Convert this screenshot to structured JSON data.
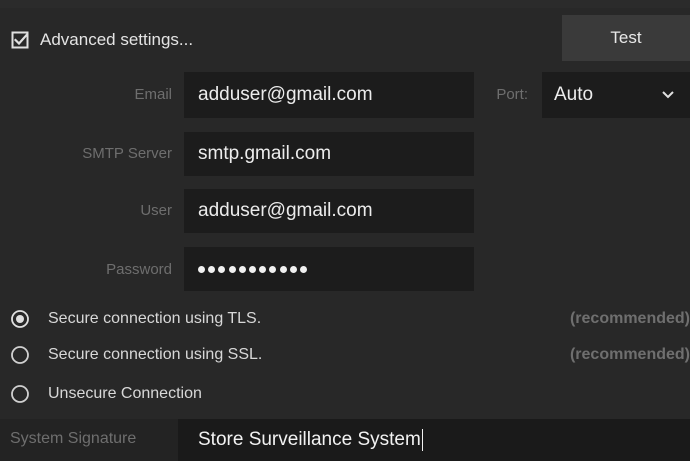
{
  "advanced": {
    "label": "Advanced settings...",
    "checked": true,
    "icon": "checkbox-checked-icon"
  },
  "test_button": {
    "label": "Test"
  },
  "fields": {
    "email": {
      "label": "Email",
      "value": "adduser@gmail.com"
    },
    "smtp_server": {
      "label": "SMTP Server",
      "value": "smtp.gmail.com"
    },
    "user": {
      "label": "User",
      "value": "adduser@gmail.com"
    },
    "password": {
      "label": "Password",
      "masked_length": 11
    }
  },
  "port": {
    "label": "Port:",
    "selected": "Auto",
    "icon": "chevron-down-icon"
  },
  "connection_options": [
    {
      "label": "Secure connection using TLS.",
      "note": "(recommended)",
      "selected": true
    },
    {
      "label": "Secure connection using SSL.",
      "note": "(recommended)",
      "selected": false
    },
    {
      "label": "Unsecure Connection",
      "note": "",
      "selected": false
    }
  ],
  "signature": {
    "label": "System Signature",
    "value": "Store Surveillance System"
  },
  "colors": {
    "background": "#282828",
    "input_background": "#1c1c1c",
    "button_background": "#3a3a3a",
    "label_text": "#6e6e6e",
    "value_text": "#ececec"
  }
}
